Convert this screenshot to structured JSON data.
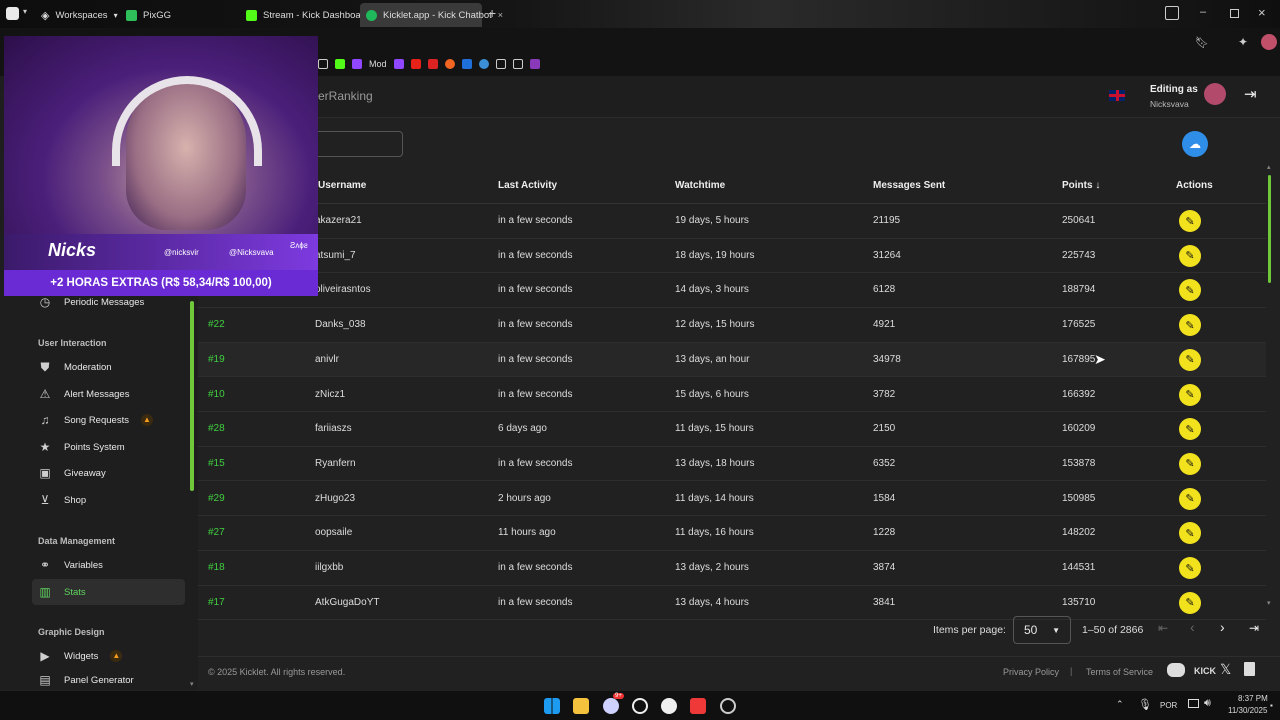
{
  "browser": {
    "workspaces_label": "Workspaces",
    "tabs": [
      {
        "label": "PixGG"
      },
      {
        "label": "Stream - Kick Dashboard"
      },
      {
        "label": "Kicklet.app - Kick Chatbot"
      }
    ],
    "bookmarks": [
      {
        "label": "Mod"
      }
    ]
  },
  "app": {
    "page_title": "erRanking",
    "editing_as_label": "Editing as",
    "editing_user": "Nicksvava"
  },
  "overlay": {
    "banner": "+2 HORAS EXTRAS (R$ 58,34/R$ 100,00)",
    "logo_text": "Nicks",
    "handle1": "@nicksvir",
    "handle2": "@Nicksvava",
    "handle3": "Ƨʌɸƨ"
  },
  "sidebar": {
    "top_item": "Periodic Messages",
    "sections": [
      {
        "title": "User Interaction",
        "items": [
          "Moderation",
          "Alert Messages",
          "Song Requests",
          "Points System",
          "Giveaway",
          "Shop"
        ]
      },
      {
        "title": "Data Management",
        "items": [
          "Variables",
          "Stats"
        ]
      },
      {
        "title": "Graphic Design",
        "items": [
          "Widgets",
          "Panel Generator"
        ]
      }
    ]
  },
  "table": {
    "columns": [
      "Username",
      "Last Activity",
      "Watchtime",
      "Messages Sent",
      "Points",
      "Actions"
    ],
    "rows": [
      {
        "rank": "",
        "username": "akazera21",
        "last_activity": "in a few seconds",
        "watchtime": "19 days, 5 hours",
        "messages": "21195",
        "points": "250641"
      },
      {
        "rank": "",
        "username": "atsumi_7",
        "last_activity": "in a few seconds",
        "watchtime": "18 days, 19 hours",
        "messages": "31264",
        "points": "225743"
      },
      {
        "rank": "",
        "username": "oliveirasntos",
        "last_activity": "in a few seconds",
        "watchtime": "14 days, 3 hours",
        "messages": "6128",
        "points": "188794"
      },
      {
        "rank": "#22",
        "username": "Danks_038",
        "last_activity": "in a few seconds",
        "watchtime": "12 days, 15 hours",
        "messages": "4921",
        "points": "176525"
      },
      {
        "rank": "#19",
        "username": "anivlr",
        "last_activity": "in a few seconds",
        "watchtime": "13 days, an hour",
        "messages": "34978",
        "points": "167895"
      },
      {
        "rank": "#10",
        "username": "zNicz1",
        "last_activity": "in a few seconds",
        "watchtime": "15 days, 6 hours",
        "messages": "3782",
        "points": "166392"
      },
      {
        "rank": "#28",
        "username": "fariiaszs",
        "last_activity": "6 days ago",
        "watchtime": "11 days, 15 hours",
        "messages": "2150",
        "points": "160209"
      },
      {
        "rank": "#15",
        "username": "Ryanfern",
        "last_activity": "in a few seconds",
        "watchtime": "13 days, 18 hours",
        "messages": "6352",
        "points": "153878"
      },
      {
        "rank": "#29",
        "username": "zHugo23",
        "last_activity": "2 hours ago",
        "watchtime": "11 days, 14 hours",
        "messages": "1584",
        "points": "150985"
      },
      {
        "rank": "#27",
        "username": "oopsaile",
        "last_activity": "11 hours ago",
        "watchtime": "11 days, 16 hours",
        "messages": "1228",
        "points": "148202"
      },
      {
        "rank": "#18",
        "username": "iilgxbb",
        "last_activity": "in a few seconds",
        "watchtime": "13 days, 2 hours",
        "messages": "3874",
        "points": "144531"
      },
      {
        "rank": "#17",
        "username": "AtkGugaDoYT",
        "last_activity": "in a few seconds",
        "watchtime": "13 days, 4 hours",
        "messages": "3841",
        "points": "135710"
      }
    ]
  },
  "pagination": {
    "items_per_page_label": "Items per page:",
    "items_per_page": "50",
    "range": "1–50 of 2866"
  },
  "footer": {
    "copyright": "© 2025 Kicklet. All rights reserved.",
    "privacy": "Privacy Policy",
    "separator": "|",
    "terms": "Terms of Service",
    "kick_label": "KICK"
  },
  "taskbar": {
    "language": "POR",
    "time": "8:37 PM",
    "date": "11/30/2025",
    "badge": "9+"
  },
  "colors": {
    "accent_green": "#3fcf3f",
    "edit_yellow": "#f2e21d",
    "banner_purple": "#6a2bd4"
  }
}
